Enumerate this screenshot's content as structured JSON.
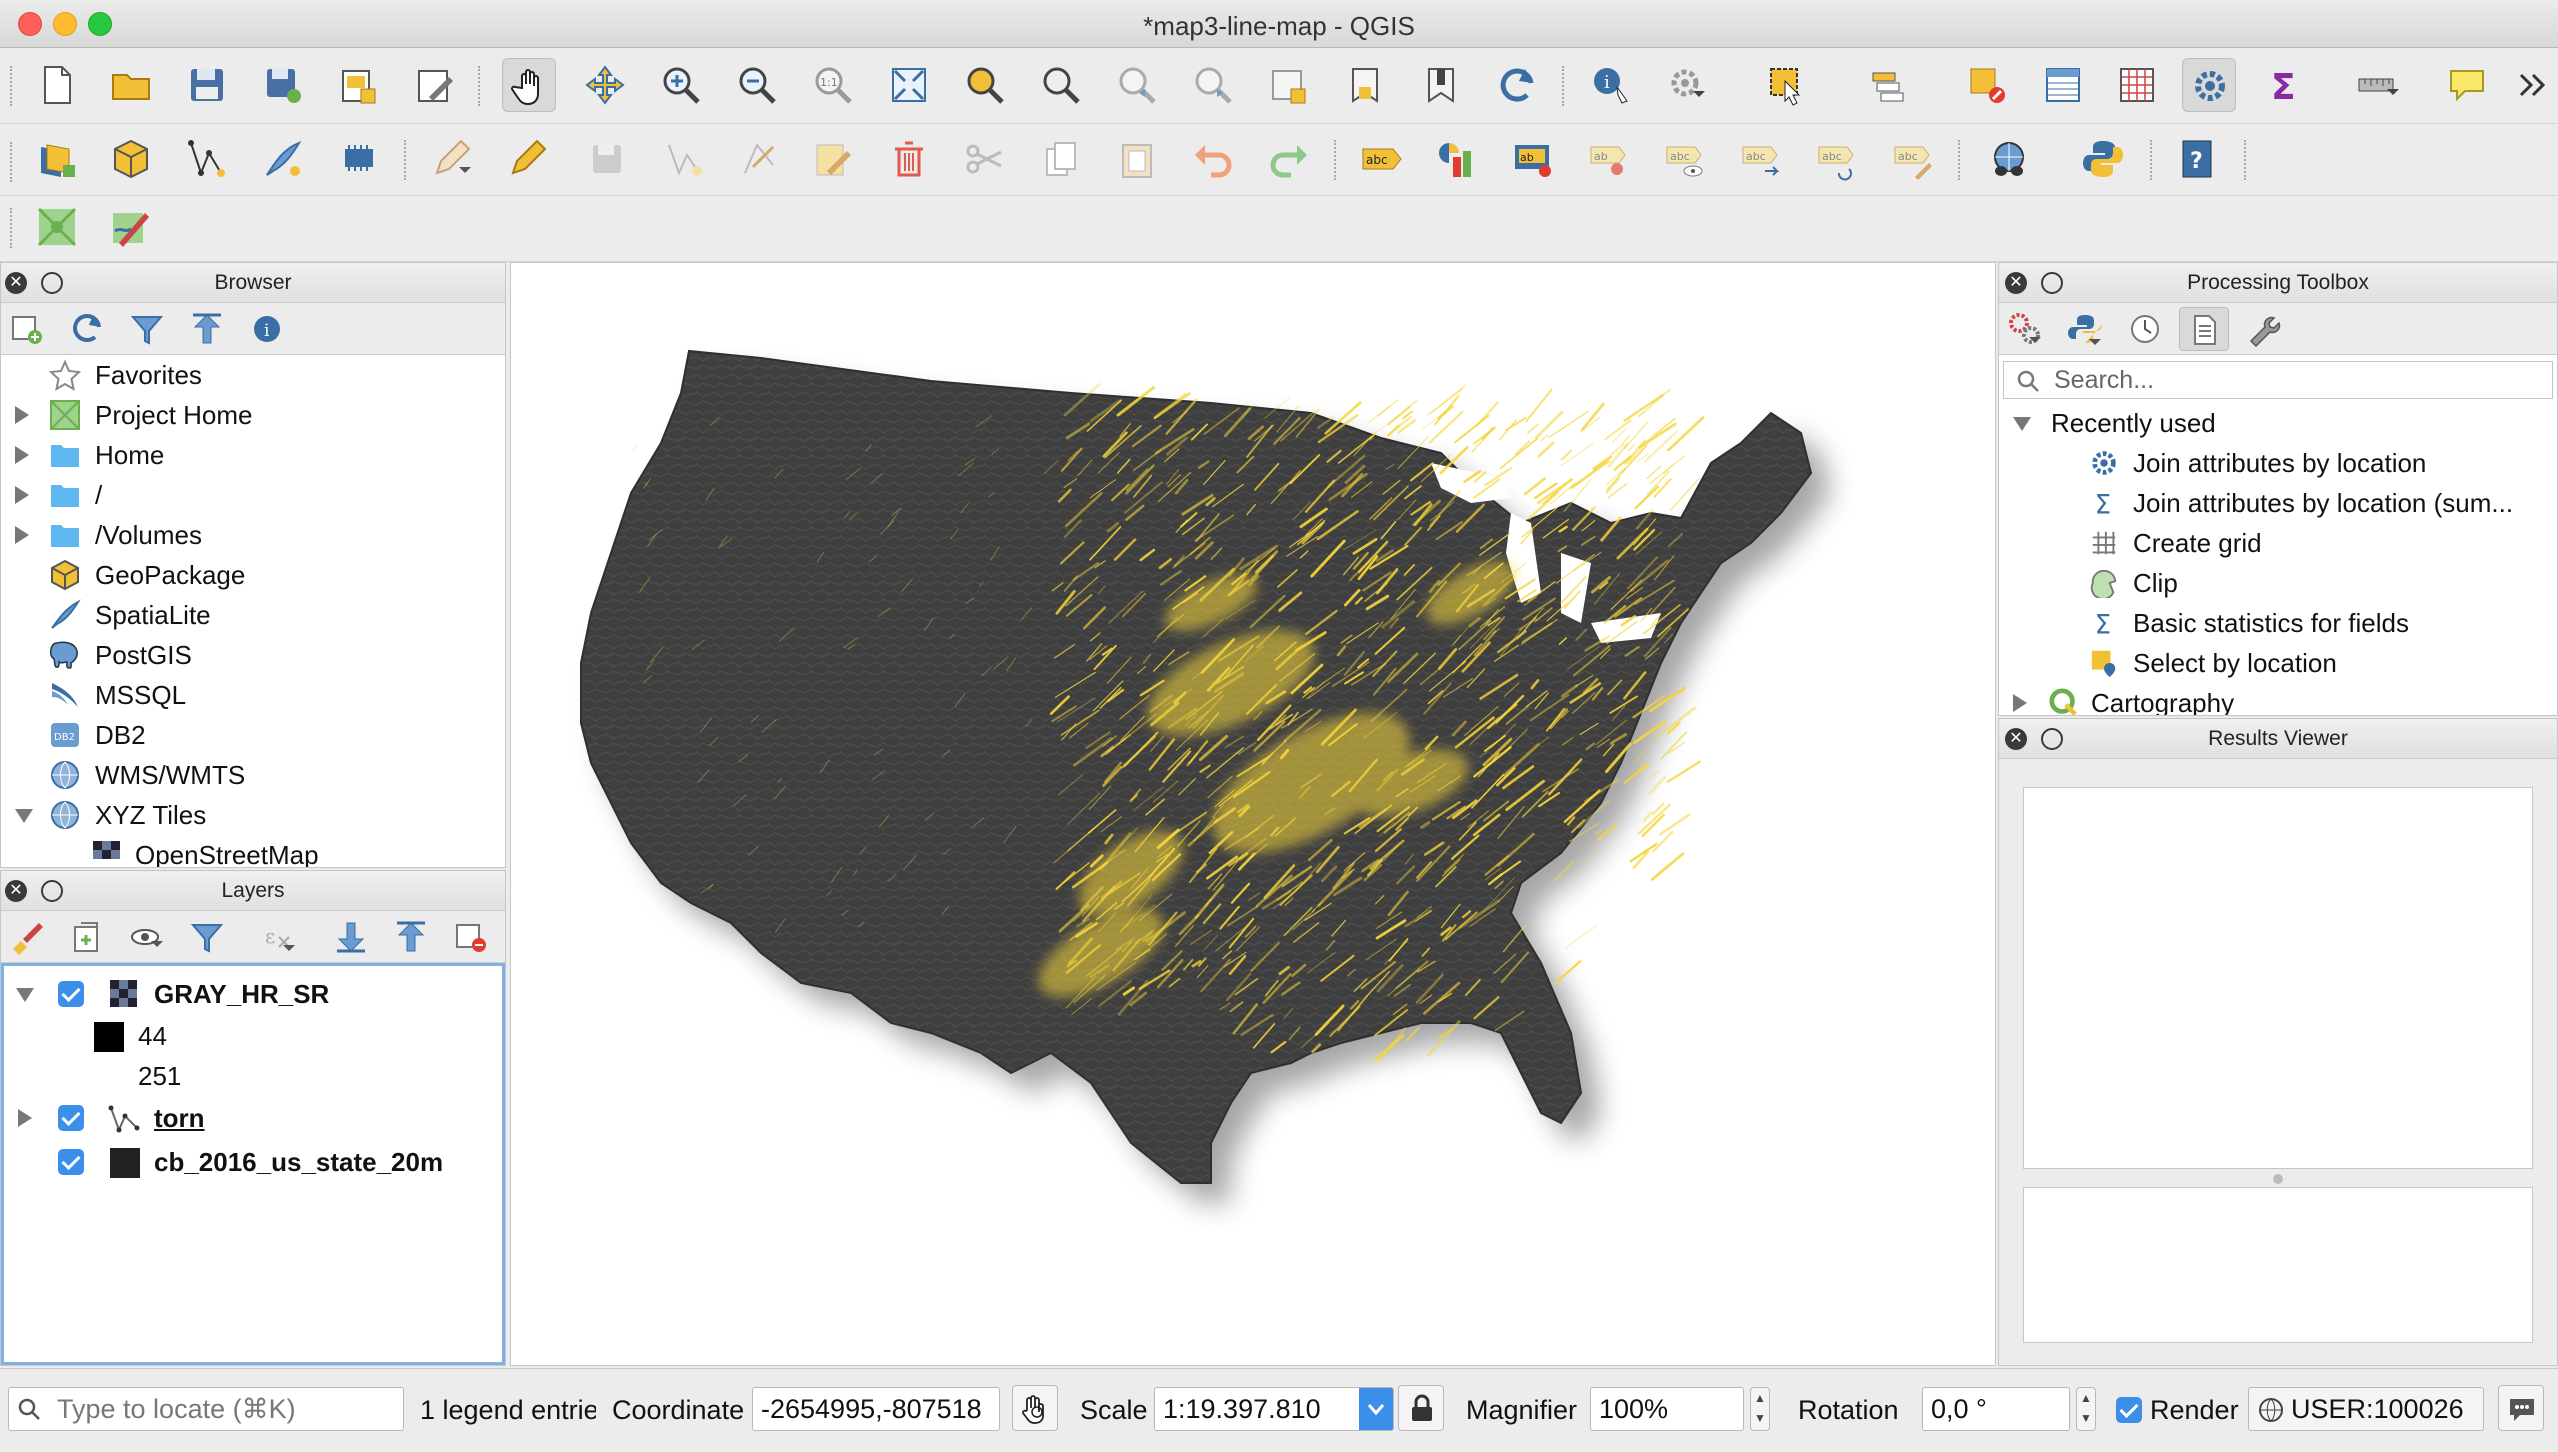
{
  "window": {
    "title": "*map3-line-map - QGIS"
  },
  "toolbar": {
    "row1": [
      "new-project",
      "open-project",
      "save-project",
      "save-as",
      "print-layout",
      "layout-manager",
      "pan",
      "pan-to-selection",
      "zoom-in",
      "zoom-out",
      "zoom-native",
      "zoom-full",
      "zoom-to-selection",
      "zoom-to-layer",
      "zoom-last",
      "zoom-next",
      "new-map-view",
      "new-bookmark",
      "show-bookmarks",
      "refresh",
      "identify",
      "actions",
      "select-features",
      "select-by-value",
      "deselect",
      "open-attribute-table",
      "field-calculator",
      "processing-toolbox",
      "statistical-summary",
      "measure",
      "map-tips"
    ],
    "row2": [
      "data-source-manager",
      "new-geopackage-layer",
      "digitize-tools",
      "digitize-edits",
      "add-feature",
      "current-edits",
      "toggle-editing",
      "save-edits",
      "vertex-tool",
      "node-tool",
      "modify-attributes",
      "delete-selected",
      "cut-features",
      "copy-features",
      "paste-features",
      "undo",
      "redo",
      "label-toolbar",
      "diagram-toolbar",
      "highlight-pinned-labels",
      "pin-labels",
      "show-hide-labels",
      "move-label",
      "rotate-label",
      "change-label",
      "qgis-cloud",
      "python-console",
      "help"
    ],
    "row3": [
      "georeferencer",
      "style-editor"
    ]
  },
  "browser": {
    "title": "Browser",
    "items": [
      {
        "label": "Favorites",
        "icon": "star-icon",
        "expandable": false
      },
      {
        "label": "Project Home",
        "icon": "project-home-icon",
        "expandable": true
      },
      {
        "label": "Home",
        "icon": "folder-icon",
        "expandable": true
      },
      {
        "label": "/",
        "icon": "folder-icon",
        "expandable": true
      },
      {
        "label": "/Volumes",
        "icon": "folder-icon",
        "expandable": true
      },
      {
        "label": "GeoPackage",
        "icon": "geopackage-icon",
        "expandable": false
      },
      {
        "label": "SpatiaLite",
        "icon": "spatialite-icon",
        "expandable": false
      },
      {
        "label": "PostGIS",
        "icon": "postgis-icon",
        "expandable": false
      },
      {
        "label": "MSSQL",
        "icon": "mssql-icon",
        "expandable": false
      },
      {
        "label": "DB2",
        "icon": "db2-icon",
        "expandable": false
      },
      {
        "label": "WMS/WMTS",
        "icon": "globe-icon",
        "expandable": false
      },
      {
        "label": "XYZ Tiles",
        "icon": "globe-icon",
        "expandable": "open"
      },
      {
        "label": "OpenStreetMap",
        "icon": "raster-icon",
        "expandable": false
      }
    ]
  },
  "layers": {
    "title": "Layers",
    "items": [
      {
        "label": "GRAY_HR_SR",
        "checked": true,
        "expanded": true,
        "legend": [
          "44",
          "251"
        ]
      },
      {
        "label": "torn",
        "checked": true,
        "expanded": false,
        "underline": true
      },
      {
        "label": "cb_2016_us_state_20m",
        "checked": true,
        "expanded": false
      }
    ]
  },
  "processing": {
    "title": "Processing Toolbox",
    "search_placeholder": "Search...",
    "recently_used": "Recently used",
    "items": [
      "Join attributes by location",
      "Join attributes by location (sum...",
      "Create grid",
      "Clip",
      "Basic statistics for fields",
      "Select by location"
    ],
    "cartography": "Cartography"
  },
  "results": {
    "title": "Results Viewer"
  },
  "status": {
    "locate_placeholder": "Type to locate (⌘K)",
    "legend_entries": "1 legend entrie",
    "coordinate_label": "Coordinate",
    "coordinate_value": "-2654995,-807518",
    "scale_label": "Scale",
    "scale_value": "1:19.397.810",
    "magnifier_label": "Magnifier",
    "magnifier_value": "100%",
    "rotation_label": "Rotation",
    "rotation_value": "0,0 °",
    "render_label": "Render",
    "crs_value": "USER:100026"
  },
  "colors": {
    "accent": "#3b8fea",
    "map_land": "#3f3f3f",
    "tornado": "#f5d63a"
  }
}
